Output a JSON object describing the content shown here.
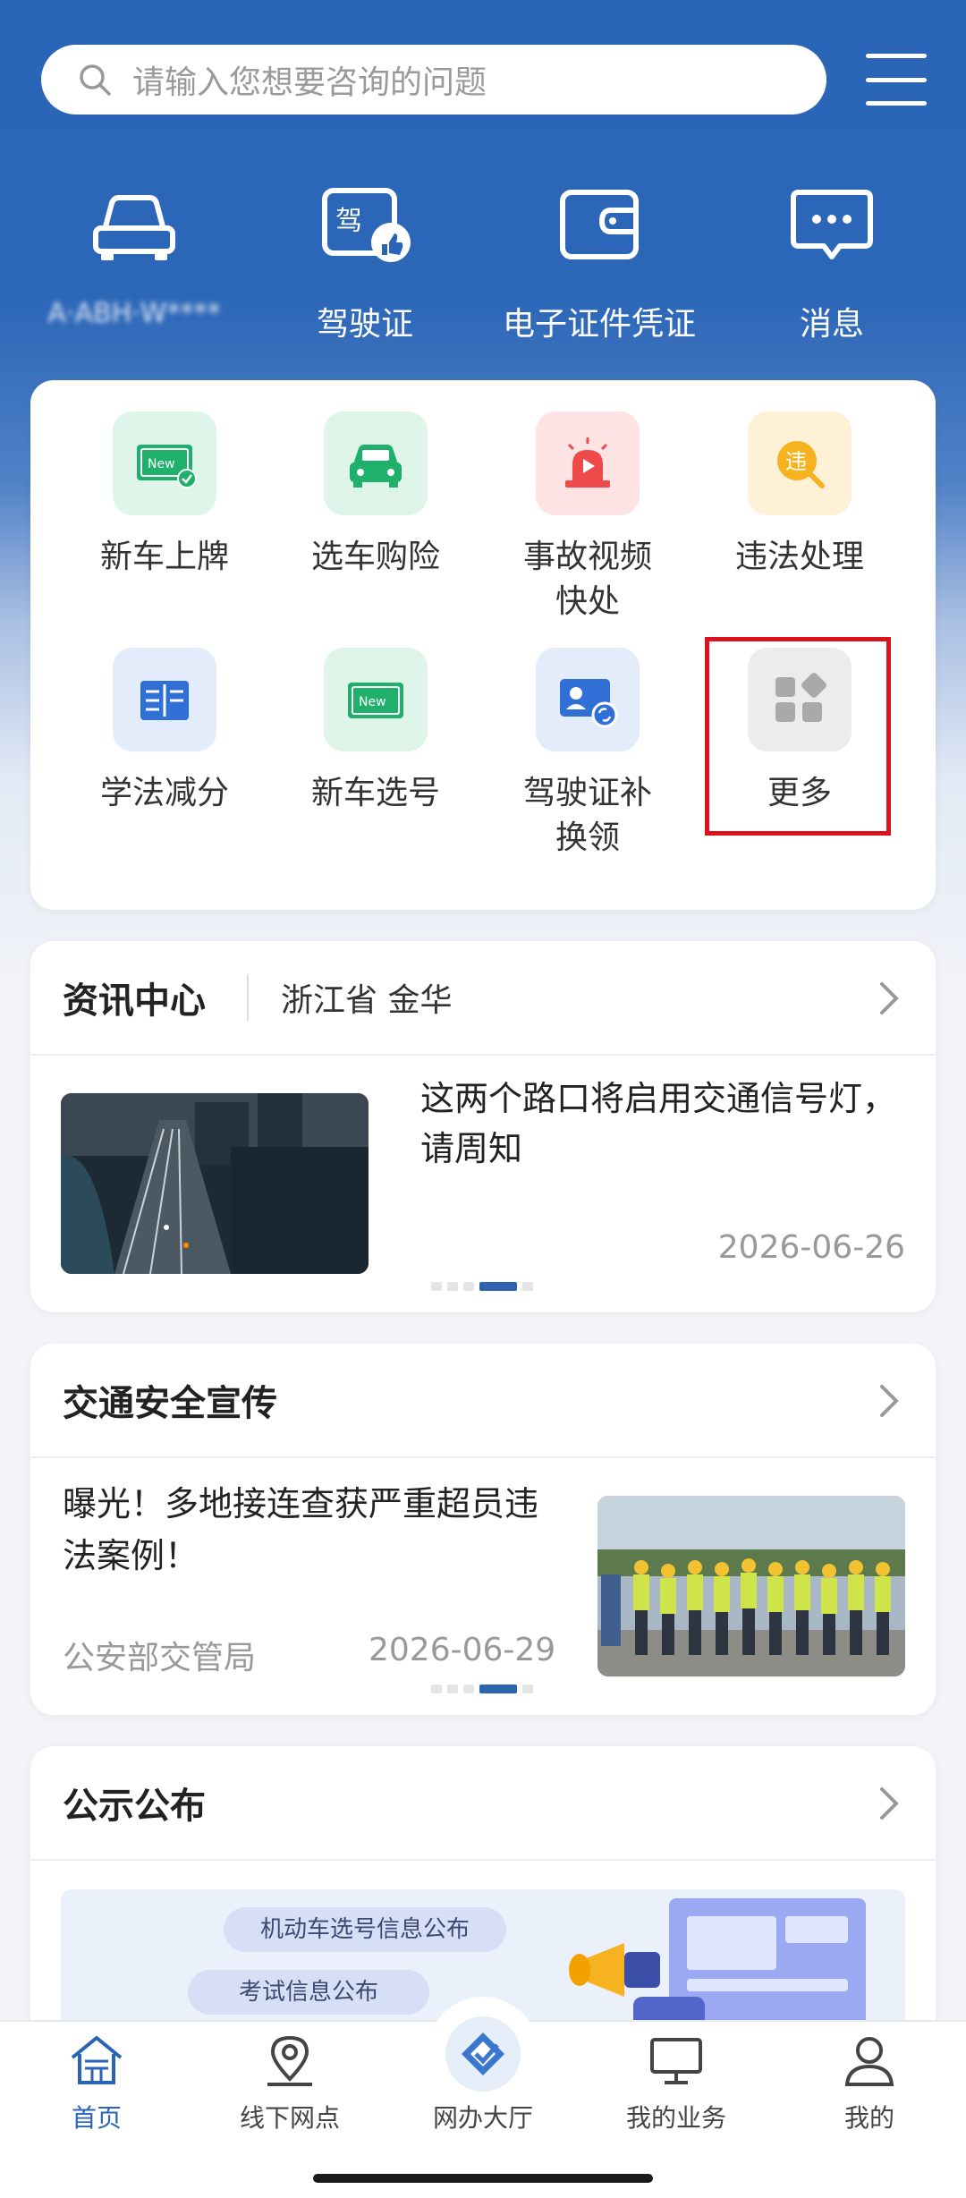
{
  "search": {
    "placeholder": "请输入您想要咨询的问题"
  },
  "quick_actions": [
    {
      "label": "A·ABH·W****",
      "icon": "car-icon"
    },
    {
      "label": "驾驶证",
      "icon": "license-icon"
    },
    {
      "label": "电子证件凭证",
      "icon": "wallet-icon"
    },
    {
      "label": "消息",
      "icon": "message-icon"
    }
  ],
  "services": [
    {
      "label": "新车上牌",
      "icon": "new-plate-icon"
    },
    {
      "label": "选车购险",
      "icon": "car-insurance-icon"
    },
    {
      "label": "事故视频快处",
      "icon": "alarm-video-icon"
    },
    {
      "label": "违法处理",
      "icon": "violation-icon"
    },
    {
      "label": "学法减分",
      "icon": "book-icon"
    },
    {
      "label": "新车选号",
      "icon": "new-number-icon"
    },
    {
      "label": "驾驶证补换领",
      "icon": "id-renew-icon"
    },
    {
      "label": "更多",
      "icon": "more-apps-icon"
    }
  ],
  "news": {
    "title": "资讯中心",
    "location": "浙江省 金华",
    "headline": "这两个路口将启用交通信号灯，请周知",
    "date": "2026-06-26"
  },
  "safety": {
    "title": "交通安全宣传",
    "headline": "曝光！多地接连查获严重超员违法案例！",
    "source": "公安部交管局",
    "date": "2026-06-29"
  },
  "notice": {
    "title": "公示公布",
    "pill1": "机动车选号信息公布",
    "pill2": "考试信息公布"
  },
  "tabs": [
    {
      "label": "首页",
      "icon": "home-icon"
    },
    {
      "label": "线下网点",
      "icon": "location-icon"
    },
    {
      "label": "网办大厅",
      "icon": "hall-icon"
    },
    {
      "label": "我的业务",
      "icon": "monitor-icon"
    },
    {
      "label": "我的",
      "icon": "user-icon"
    }
  ],
  "colors": {
    "primary": "#2a64b6",
    "highlight": "#d9121b"
  }
}
